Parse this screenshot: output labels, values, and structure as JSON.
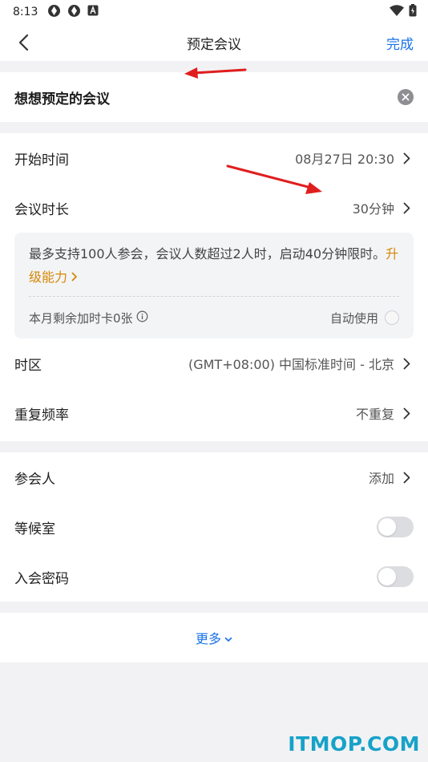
{
  "status_bar": {
    "time": "8:13"
  },
  "nav": {
    "title": "预定会议",
    "done_label": "完成"
  },
  "subject": {
    "text": "想想预定的会议"
  },
  "settings": {
    "start_time": {
      "label": "开始时间",
      "value": "08月27日 20:30"
    },
    "duration": {
      "label": "会议时长",
      "value": "30分钟"
    },
    "info": {
      "text": "最多支持100人参会，会议人数超过2人时，启动40分钟限时。",
      "upgrade_label": "升级能力",
      "remaining_label": "本月剩余加时卡0张",
      "auto_use_label": "自动使用"
    },
    "timezone": {
      "label": "时区",
      "value": "(GMT+08:00) 中国标准时间 - 北京"
    },
    "repeat": {
      "label": "重复频率",
      "value": "不重复"
    }
  },
  "participants": {
    "attendees": {
      "label": "参会人",
      "value": "添加"
    },
    "waiting_room": {
      "label": "等候室",
      "enabled": false
    },
    "password": {
      "label": "入会密码",
      "enabled": false
    }
  },
  "more": {
    "label": "更多"
  },
  "watermark": "ITMOP.COM",
  "colors": {
    "accent": "#1a73e8",
    "upgrade": "#d48806",
    "annotation": "#e01e1e"
  }
}
